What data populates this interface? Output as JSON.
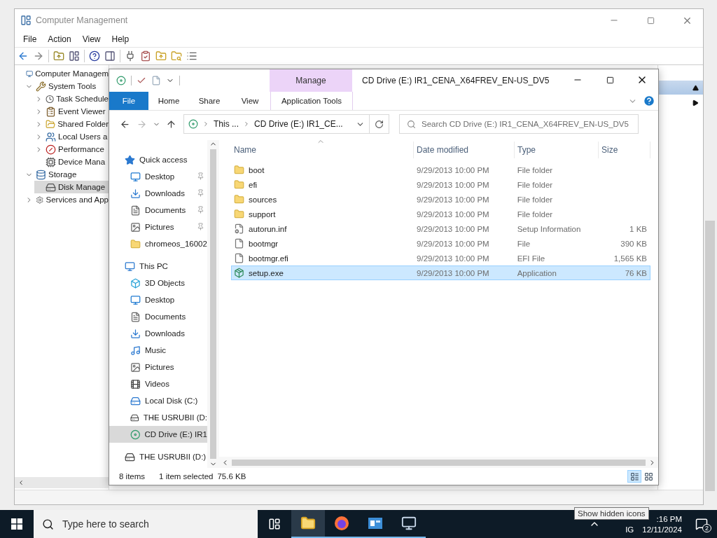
{
  "cm_window": {
    "title": "Computer Management",
    "menu": [
      "File",
      "Action",
      "View",
      "Help"
    ],
    "tree": [
      {
        "label": "Computer Managem",
        "kind": "computer",
        "selected": false,
        "children": [
          {
            "label": "System Tools",
            "kind": "tools",
            "expanded": true,
            "selected": false,
            "children": [
              {
                "label": "Task Schedule",
                "kind": "clock",
                "expanded": false,
                "selected": false
              },
              {
                "label": "Event Viewer",
                "kind": "event",
                "expanded": false,
                "selected": false
              },
              {
                "label": "Shared Folder",
                "kind": "shared",
                "expanded": false,
                "selected": false
              },
              {
                "label": "Local Users a",
                "kind": "users",
                "expanded": false,
                "selected": false
              },
              {
                "label": "Performance",
                "kind": "performance",
                "expanded": false,
                "selected": false
              },
              {
                "label": "Device Mana",
                "kind": "device",
                "selected": false
              }
            ]
          },
          {
            "label": "Storage",
            "kind": "storage",
            "expanded": true,
            "selected": false,
            "children": [
              {
                "label": "Disk Manage",
                "kind": "disk",
                "selected": true
              }
            ]
          },
          {
            "label": "Services and App",
            "kind": "services",
            "expanded": false,
            "selected": false
          }
        ]
      }
    ]
  },
  "explorer": {
    "title": "CD Drive (E:) IR1_CENA_X64FREV_EN-US_DV5",
    "ribbon": {
      "context_group": "Manage",
      "tabs": [
        {
          "label": "File",
          "kind": "file"
        },
        {
          "label": "Home",
          "kind": "plain"
        },
        {
          "label": "Share",
          "kind": "plain"
        },
        {
          "label": "View",
          "kind": "plain"
        },
        {
          "label": "Application Tools",
          "kind": "context"
        }
      ]
    },
    "address": {
      "crumbs": [
        "This ...",
        "CD Drive (E:) IR1_CE..."
      ]
    },
    "search": {
      "placeholder": "Search CD Drive (E:) IR1_CENA_X64FREV_EN-US_DV5"
    },
    "nav": [
      {
        "label": "Quick access",
        "kind": "star",
        "selected": false,
        "children": [
          {
            "label": "Desktop",
            "kind": "desktop",
            "pinned": true,
            "selected": false
          },
          {
            "label": "Downloads",
            "kind": "download",
            "pinned": true,
            "selected": false
          },
          {
            "label": "Documents",
            "kind": "document",
            "pinned": true,
            "selected": false
          },
          {
            "label": "Pictures",
            "kind": "picture",
            "pinned": true,
            "selected": false
          },
          {
            "label": "chromeos_16002",
            "kind": "folder",
            "pinned": false,
            "selected": false
          }
        ]
      },
      {
        "label": "This PC",
        "kind": "pc",
        "selected": false,
        "children": [
          {
            "label": "3D Objects",
            "kind": "cube",
            "selected": false
          },
          {
            "label": "Desktop",
            "kind": "desktop",
            "selected": false
          },
          {
            "label": "Documents",
            "kind": "document",
            "selected": false
          },
          {
            "label": "Downloads",
            "kind": "download",
            "selected": false
          },
          {
            "label": "Music",
            "kind": "music",
            "selected": false
          },
          {
            "label": "Pictures",
            "kind": "picture",
            "selected": false
          },
          {
            "label": "Videos",
            "kind": "video",
            "selected": false
          },
          {
            "label": "Local Disk (C:)",
            "kind": "disk",
            "selected": false
          },
          {
            "label": "THE USRUBII (D:",
            "kind": "usb",
            "selected": false
          },
          {
            "label": "CD Drive (E:) IR1",
            "kind": "cd",
            "selected": true
          }
        ]
      },
      {
        "label": "THE USRUBII (D:)",
        "kind": "usb",
        "selected": false
      }
    ],
    "columns": [
      "Name",
      "Date modified",
      "Type",
      "Size"
    ],
    "files": [
      {
        "name": "boot",
        "date": "9/29/2013 10:00 PM",
        "type": "File folder",
        "kind": "folder",
        "selected": false
      },
      {
        "name": "efi",
        "date": "9/29/2013 10:00 PM",
        "type": "File folder",
        "kind": "folder",
        "selected": false
      },
      {
        "name": "sources",
        "date": "9/29/2013 10:00 PM",
        "type": "File folder",
        "kind": "folder",
        "selected": false
      },
      {
        "name": "support",
        "date": "9/29/2013 10:00 PM",
        "type": "File folder",
        "kind": "folder",
        "selected": false
      },
      {
        "name": "autorun.inf",
        "date": "9/29/2013 10:00 PM",
        "type": "Setup Information",
        "size": "1 KB",
        "kind": "settings",
        "selected": false
      },
      {
        "name": "bootmgr",
        "date": "9/29/2013 10:00 PM",
        "type": "File",
        "size": "390 KB",
        "kind": "file",
        "selected": false
      },
      {
        "name": "bootmgr.efi",
        "date": "9/29/2013 10:00 PM",
        "type": "EFI File",
        "size": "1,565 KB",
        "kind": "file",
        "selected": false
      },
      {
        "name": "setup.exe",
        "date": "9/29/2013 10:00 PM",
        "type": "Application",
        "size": "76 KB",
        "kind": "app",
        "selected": true
      }
    ],
    "status": {
      "count": "8 items",
      "selection": "1 item selected",
      "size": "75.6 KB"
    },
    "view_modes": [
      {
        "kind": "details",
        "selected": true
      },
      {
        "kind": "large",
        "selected": false
      }
    ]
  },
  "taskbar": {
    "search_placeholder": "Type here to search",
    "apps": [
      {
        "kind": "explorer",
        "active": true
      },
      {
        "kind": "firefox",
        "active": false
      },
      {
        "kind": "app",
        "active": false
      },
      {
        "kind": "network",
        "active": false
      }
    ],
    "tooltip": "Show hidden icons",
    "time": ":16 PM",
    "language": "IG",
    "date": "12/11/2024",
    "notifications": "2"
  }
}
